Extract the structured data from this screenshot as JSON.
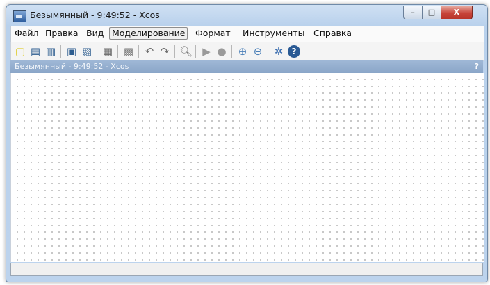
{
  "window": {
    "title": "Безымянный - 9:49:52 - Xcos",
    "controls": {
      "minimize": "–",
      "maximize": "□",
      "close": "X"
    }
  },
  "menu": {
    "items": [
      {
        "label": "Файл"
      },
      {
        "label": "Правка"
      },
      {
        "label": "Вид"
      },
      {
        "label": "Моделирование",
        "active": true
      },
      {
        "label": "Формат"
      },
      {
        "label": "Инструменты"
      },
      {
        "label": "Справка"
      }
    ]
  },
  "toolbar": {
    "icons": [
      {
        "name": "new-diagram-icon",
        "glyph": "▢",
        "color": "#d9c300"
      },
      {
        "name": "open-icon",
        "glyph": "▤",
        "color": "#2d5d8f"
      },
      {
        "name": "open-file-icon",
        "glyph": "▥",
        "color": "#2d5d8f"
      },
      {
        "name": "save-icon",
        "glyph": "▣",
        "color": "#2d5d8f"
      },
      {
        "name": "save-as-icon",
        "glyph": "▧",
        "color": "#2d5d8f"
      },
      {
        "name": "print-icon",
        "glyph": "▦",
        "color": "#6b6b6b"
      },
      {
        "name": "delete-icon",
        "glyph": "▩",
        "color": "#7a7a7a"
      },
      {
        "name": "undo-icon",
        "glyph": "↶",
        "color": "#6f6f6f"
      },
      {
        "name": "redo-icon",
        "glyph": "↷",
        "color": "#6f6f6f"
      },
      {
        "name": "fit-diagram-icon",
        "glyph": "🔍︎",
        "color": "#7a7a7a"
      },
      {
        "name": "start-icon",
        "glyph": "▶",
        "color": "#9a9a9a"
      },
      {
        "name": "stop-icon",
        "glyph": "●",
        "color": "#9a9a9a"
      },
      {
        "name": "zoom-in-icon",
        "glyph": "⊕",
        "color": "#4a7fb8"
      },
      {
        "name": "zoom-out-icon",
        "glyph": "⊖",
        "color": "#4a7fb8"
      },
      {
        "name": "palette-browser-icon",
        "glyph": "✲",
        "color": "#3d6fb0"
      },
      {
        "name": "help-icon",
        "glyph": "?",
        "color": "#ffffff"
      }
    ]
  },
  "document": {
    "header_title": "Безымянный - 9:49:52 - Xcos",
    "help_mark": "?"
  },
  "status": {
    "text": ""
  }
}
